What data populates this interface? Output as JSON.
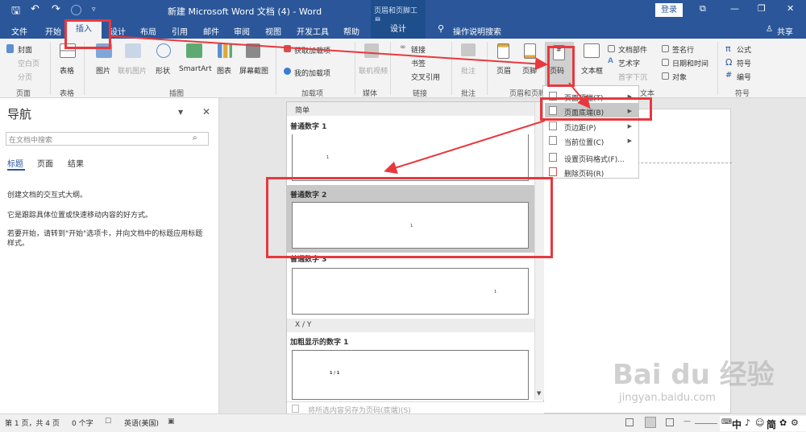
{
  "window": {
    "title": "新建 Microsoft Word 文档 (4)  -  Word",
    "context_title": "页眉和页脚工具",
    "login_label": "登录"
  },
  "tabs": [
    "文件",
    "开始",
    "插入",
    "设计",
    "布局",
    "引用",
    "邮件",
    "审阅",
    "视图",
    "开发工具",
    "帮助"
  ],
  "context_tab": "设计",
  "search_label": "操作说明搜索",
  "share_label": "共享",
  "ribbon": {
    "page": {
      "items": [
        "封面",
        "空白页",
        "分页"
      ],
      "group": "页面"
    },
    "table": {
      "label": "表格",
      "group": "表格"
    },
    "illustrations": {
      "items": [
        "图片",
        "联机图片",
        "形状",
        "SmartArt",
        "图表",
        "屏幕截图"
      ],
      "group": "插图"
    },
    "addins": {
      "items": [
        "获取加载项",
        "我的加载项"
      ],
      "group": "加载项"
    },
    "media": {
      "item": "联机视频",
      "group": "媒体"
    },
    "links": {
      "items": [
        "链接",
        "书签",
        "交叉引用"
      ],
      "group": "链接"
    },
    "comments": {
      "item": "批注",
      "group": "批注"
    },
    "headerfooter": {
      "items": [
        "页眉",
        "页脚",
        "页码"
      ],
      "group": "页眉和页脚"
    },
    "text": {
      "items": [
        "文本框",
        "文档部件",
        "艺术字",
        "首字下沉",
        "签名行",
        "日期和时间",
        "对象"
      ],
      "group": "文本"
    },
    "symbols": {
      "items": [
        "公式",
        "符号",
        "编号"
      ],
      "group": "符号"
    }
  },
  "nav": {
    "title": "导航",
    "search_placeholder": "在文档中搜索",
    "tabs": [
      "标题",
      "页面",
      "结果"
    ],
    "lines": [
      "创建文档的交互式大纲。",
      "它是跟踪具体位置或快速移动内容的好方式。",
      "若要开始，请转到\"开始\"选项卡，并向文档中的标题应用标题",
      "样式。"
    ]
  },
  "gallery": {
    "section1": "简单",
    "items": [
      {
        "title": "普通数字 1",
        "num": "1"
      },
      {
        "title": "普通数字 2",
        "num": "1"
      },
      {
        "title": "普通数字 3",
        "num": "1"
      }
    ],
    "section2": "X / Y",
    "item4": {
      "title": "加粗显示的数字 1",
      "num": "1 / 1"
    },
    "footer": "将所选内容另存为页码(底端)(S)"
  },
  "menu": {
    "items": [
      "页面顶端(T)",
      "页面底端(B)",
      "页边距(P)",
      "当前位置(C)",
      "设置页码格式(F)...",
      "删除页码(R)"
    ]
  },
  "status": {
    "page": "第 1 页，共 4 页",
    "words": "0 个字",
    "lang": "英语(美国)",
    "ime": "中",
    "ime_extra": "简"
  },
  "watermark": {
    "brand": "Bai du 经验",
    "url": "jingyan.baidu.com"
  },
  "colors": {
    "title_blue": "#2b579a",
    "highlight": "#e8383d"
  }
}
